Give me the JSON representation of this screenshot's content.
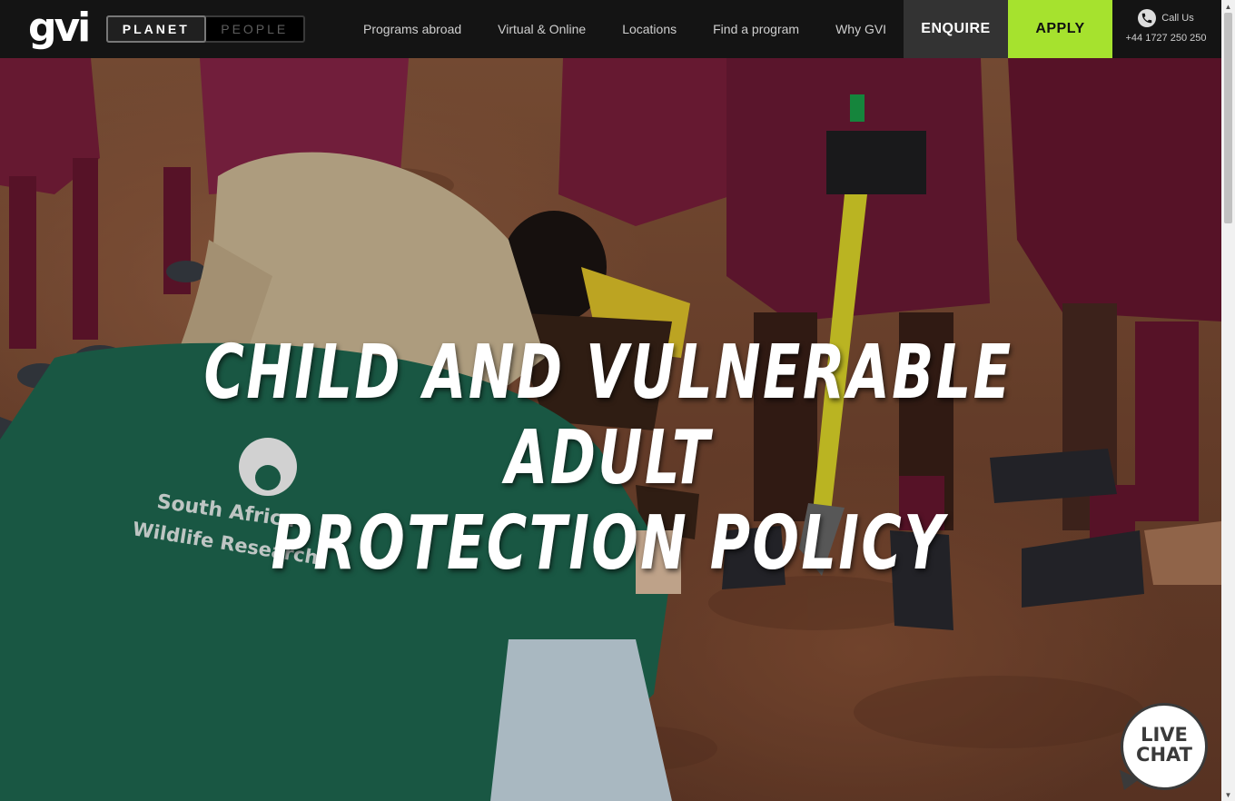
{
  "header": {
    "logo": "gvi",
    "toggle": {
      "active": "PLANET",
      "inactive": "PEOPLE"
    },
    "nav": [
      {
        "label": "Programs abroad"
      },
      {
        "label": "Virtual & Online"
      },
      {
        "label": "Locations"
      },
      {
        "label": "Find a program"
      },
      {
        "label": "Why GVI"
      }
    ],
    "enquire_label": "ENQUIRE",
    "apply_label": "APPLY",
    "call_label": "Call Us",
    "call_number": "+44 1727 250 250",
    "phone_icon": "phone-icon"
  },
  "hero": {
    "title_line1": "CHILD AND VULNERABLE ADULT",
    "title_line2": "PROTECTION POLICY",
    "shirt_text_line1": "South Africa",
    "shirt_text_line2": "Wildlife Research"
  },
  "livechat": {
    "line1": "LIVE",
    "line2": "CHAT"
  },
  "colors": {
    "header_bg": "#141414",
    "apply_bg": "#a6e22e",
    "enquire_bg": "#333333",
    "shirt_green": "#1f6b52",
    "uniform_maroon": "#7d1f3c"
  }
}
